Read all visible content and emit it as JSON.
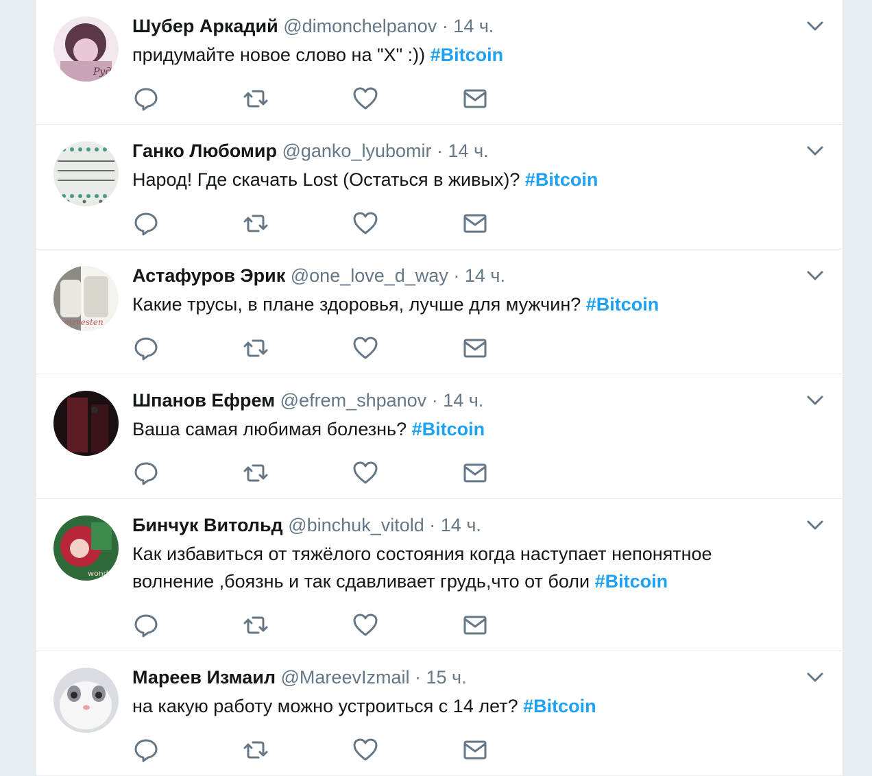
{
  "tweets": [
    {
      "name": "Шубер Аркадий",
      "handle": "@dimonchelpanov",
      "dot": "·",
      "time": "14 ч.",
      "text": "придумайте новое слово на \"Х\" :))",
      "hashtag": "#Bitcoin",
      "avatar_colors": [
        "#c9a3b6",
        "#5a3848",
        "#f3e7ee"
      ]
    },
    {
      "name": "Ганко Любомир",
      "handle": "@ganko_lyubomir",
      "dot": "·",
      "time": "14 ч.",
      "text": "Народ! Где скачать Lost (Остаться в живых)?",
      "hashtag": "#Bitcoin",
      "avatar_colors": [
        "#e9ece6",
        "#4a9a86",
        "#6a6a6a"
      ]
    },
    {
      "name": "Астафуров Эрик",
      "handle": "@one_love_d_way",
      "dot": "·",
      "time": "14 ч.",
      "text": "Какие трусы, в плане здоровья, лучше для мужчин?",
      "hashtag": "#Bitcoin",
      "avatar_colors": [
        "#d8d5cd",
        "#8c8a84",
        "#f5f3ee"
      ]
    },
    {
      "name": "Шпанов Ефрем",
      "handle": "@efrem_shpanov",
      "dot": "·",
      "time": "14 ч.",
      "text": "Ваша самая любимая болезнь?",
      "hashtag": "#Bitcoin",
      "avatar_colors": [
        "#1a1012",
        "#5c1a22",
        "#2a2a30"
      ]
    },
    {
      "name": "Бинчук Витольд",
      "handle": "@binchuk_vitold",
      "dot": "·",
      "time": "14 ч.",
      "text_line1": "Как избавиться от тяжёлого состояния когда наступает непонятное",
      "text": "волнение ,боязнь и так сдавливает грудь,что от боли",
      "hashtag": "#Bitcoin",
      "avatar_colors": [
        "#b8263a",
        "#2f6b3a",
        "#f0d0c8"
      ]
    },
    {
      "name": "Мареев Измаил",
      "handle": "@MareevIzmail",
      "dot": "·",
      "time": "15 ч.",
      "text": "на какую работу можно устроиться с 14 лет?",
      "hashtag": "#Bitcoin",
      "avatar_colors": [
        "#d9dde2",
        "#8c8f96",
        "#f6f6f6"
      ]
    }
  ],
  "icons": {
    "reply": "reply-icon",
    "retweet": "retweet-icon",
    "like": "heart-icon",
    "message": "envelope-icon",
    "caret": "chevron-down-icon"
  },
  "colors": {
    "hashtag": "#1da1f2",
    "secondary_text": "#657786",
    "icon": "#657786",
    "divider": "#e6ecf0"
  }
}
